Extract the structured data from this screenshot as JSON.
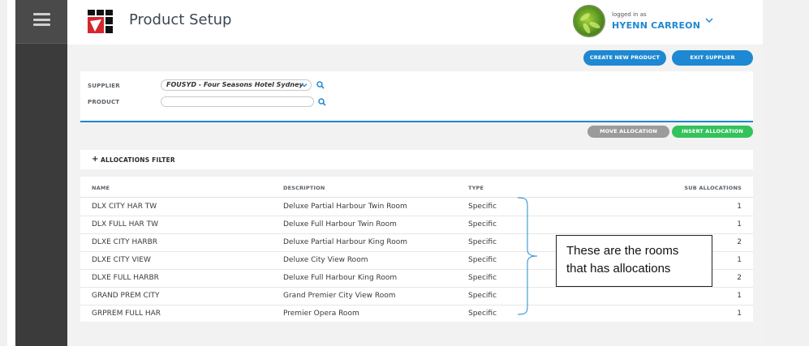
{
  "header": {
    "title": "Product Setup",
    "logged_in_label": "logged in as",
    "user_name": "HYENN CARREON"
  },
  "actions": {
    "create_product": "CREATE NEW PRODUCT",
    "exit_supplier": "EXIT SUPPLIER",
    "move_allocation": "MOVE ALLOCATION",
    "insert_allocation": "INSERT ALLOCATION"
  },
  "search": {
    "supplier_label": "SUPPLIER",
    "supplier_value": "FOUSYD - Four Seasons Hotel Sydney",
    "product_label": "PRODUCT",
    "product_value": ""
  },
  "filter": {
    "plus": "+",
    "label": "ALLOCATIONS FILTER"
  },
  "table": {
    "columns": [
      "NAME",
      "DESCRIPTION",
      "TYPE",
      "SUB ALLOCATIONS"
    ],
    "rows": [
      {
        "name": "DLX CITY HAR TW",
        "description": "Deluxe Partial Harbour Twin Room",
        "type": "Specific",
        "sub": "1"
      },
      {
        "name": "DLX FULL HAR TW",
        "description": "Deluxe Full Harbour Twin Room",
        "type": "Specific",
        "sub": "1"
      },
      {
        "name": "DLXE CITY HARBR",
        "description": "Deluxe Partial Harbour King Room",
        "type": "Specific",
        "sub": "2"
      },
      {
        "name": "DLXE CITY VIEW",
        "description": "Deluxe City View Room",
        "type": "Specific",
        "sub": "1"
      },
      {
        "name": "DLXE FULL HARBR",
        "description": "Deluxe Full Harbour King Room",
        "type": "Specific",
        "sub": "2"
      },
      {
        "name": "GRAND PREM CITY",
        "description": "Grand Premier City View Room",
        "type": "Specific",
        "sub": "1"
      },
      {
        "name": "GRPREM FULL HAR",
        "description": "Premier Opera Room",
        "type": "Specific",
        "sub": "1"
      }
    ]
  },
  "annotation": {
    "line1": "These are the rooms",
    "line2": "that has allocations"
  },
  "colors": {
    "accent": "#1e88d2",
    "insert": "#32c35a",
    "move": "#9b9b9b",
    "sidebar": "#3b3b3b"
  },
  "icons": [
    "hamburger-menu-icon",
    "company-logo",
    "user-avatar",
    "chevron-down-icon",
    "search-icon",
    "plus-icon"
  ]
}
